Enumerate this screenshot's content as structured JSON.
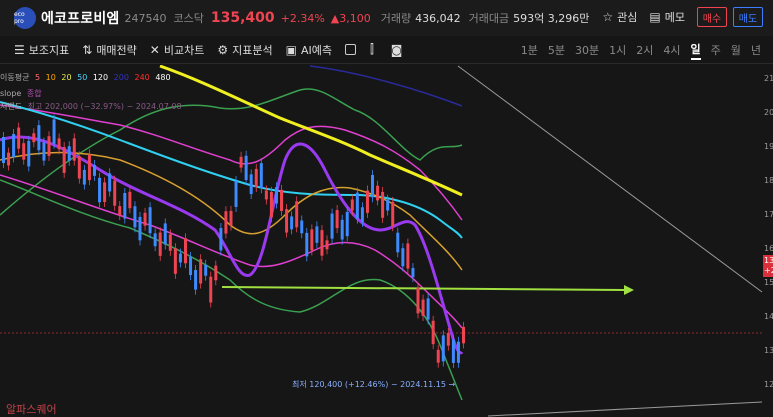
{
  "header": {
    "logo_text": "eco pro",
    "stock_name": "에코프로비엠",
    "stock_code": "247540",
    "market": "코스닥",
    "price": "135,400",
    "change_pct": "+2.34%",
    "change_amt": "▲3,100",
    "volume_label": "거래량",
    "volume_value": "436,042",
    "amount_label": "거래대금",
    "amount_value": "593억 3,296만",
    "watch_label": "관심",
    "memo_label": "메모",
    "buy_label": "매수",
    "sell_label": "매도"
  },
  "toolbar": {
    "tools": [
      "보조지표",
      "매매전략",
      "비교차트",
      "지표분석",
      "AI예측"
    ],
    "timeframes": [
      "1분",
      "5분",
      "30분",
      "1시",
      "2시",
      "4시",
      "일",
      "주",
      "월",
      "년"
    ],
    "active_timeframe": "일"
  },
  "legend": {
    "ma_label": "이동평균",
    "ma_periods": [
      "5",
      "10",
      "20",
      "50",
      "120",
      "200",
      "240",
      "480"
    ],
    "ma_colors": [
      "#ff6b6b",
      "#ffa500",
      "#e8e84a",
      "#4ad0ff",
      "#ffffff",
      "#3030c8",
      "#ff3030",
      "#ffffff"
    ],
    "line2_label": "slope",
    "line2_value": "종합",
    "line3_label": "저밴드",
    "line3_value": "최고 202,000 (−32.97%) − 2024.07.08"
  },
  "annotation": {
    "low_label": "최저 120,400 (+12.46%) − 2024.11.15 →"
  },
  "right_axis": [
    "21",
    "20",
    "19",
    "18",
    "17",
    "16",
    "15",
    "14",
    "13",
    "+2",
    "13",
    "12"
  ],
  "watermark": "알파스퀘어",
  "colors": {
    "up": "#f04452",
    "down": "#3d8bff",
    "ma_yellow": "#f0f020",
    "ma_cyan": "#30d0f0",
    "band_magenta": "#e040d0",
    "band_green": "#3aa050",
    "band_purple": "#9a3af0",
    "arrow_green": "#a0e040"
  }
}
